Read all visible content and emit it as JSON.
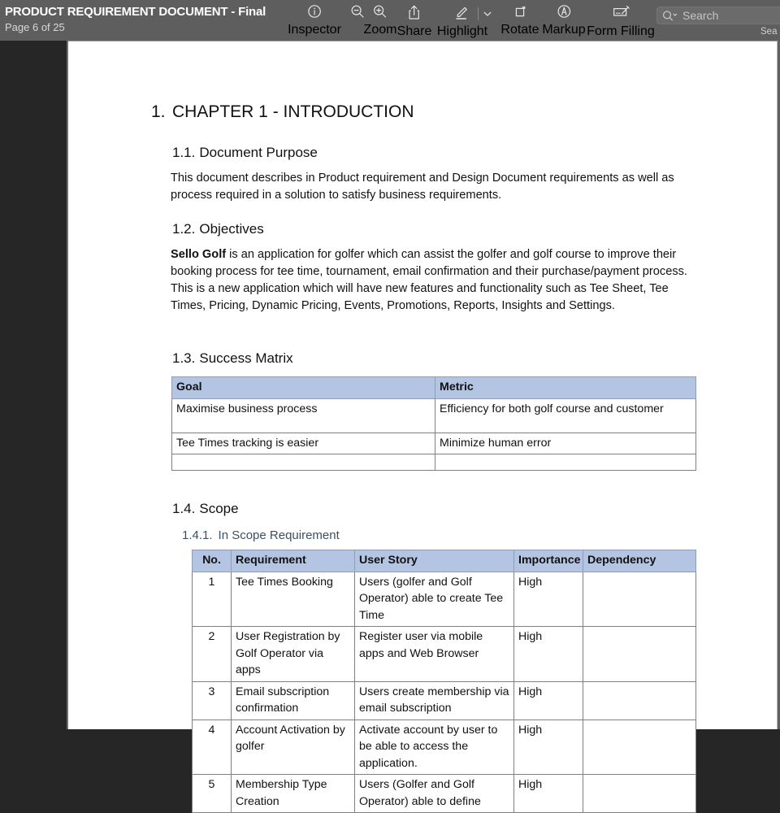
{
  "toolbar": {
    "document_title": "PRODUCT REQUIREMENT DOCUMENT - Final",
    "page_count": "Page 6 of 25",
    "tools": [
      {
        "name": "inspector",
        "icon": "info-circle-icon",
        "label": "Inspector"
      },
      {
        "name": "zoom-out",
        "icon": "zoom-out-icon",
        "label": ""
      },
      {
        "name": "zoom-in",
        "icon": "zoom-in-icon",
        "label": "Zoom"
      },
      {
        "name": "share",
        "icon": "share-icon",
        "label": "Share"
      },
      {
        "name": "highlight",
        "icon": "highlight-pen-icon",
        "label": "Highlight"
      },
      {
        "name": "rotate",
        "icon": "rotate-icon",
        "label": "Rotate"
      },
      {
        "name": "markup",
        "icon": "markup-icon",
        "label": "Markup"
      },
      {
        "name": "form-filling",
        "icon": "form-filling-icon",
        "label": "Form Filling"
      }
    ],
    "search": {
      "placeholder": "Search",
      "label": "Sea"
    }
  },
  "document": {
    "chapter": {
      "number": "1.",
      "title": "CHAPTER 1 - INTRODUCTION"
    },
    "sections": {
      "document_purpose": {
        "number": "1.1.",
        "title": "Document Purpose",
        "body": "This document describes in Product requirement and Design Document requirements as well as process required in a solution to satisfy business requirements."
      },
      "objectives": {
        "number": "1.2.",
        "title": "Objectives",
        "body_bold": "Sello Golf",
        "body": " is an application for golfer which can assist the golfer and golf course to improve their booking process for tee time, tournament, email confirmation and their purchase/payment process.  This is a new application which will have new features and functionality such as Tee Sheet, Tee Times, Pricing, Dynamic Pricing, Events, Promotions, Reports, Insights and Settings."
      },
      "success_matrix": {
        "number": "1.3.",
        "title": "Success Matrix",
        "table": {
          "headers": [
            "Goal",
            "Metric"
          ],
          "rows": [
            [
              "Maximise business process",
              "Efficiency for both golf course and customer"
            ],
            [
              "Tee Times tracking is easier",
              "Minimize human error"
            ],
            [
              "",
              ""
            ]
          ]
        }
      },
      "scope": {
        "number": "1.4.",
        "title": "Scope",
        "subsection": {
          "number": "1.4.1.",
          "title": "In Scope Requirement",
          "table": {
            "headers": [
              "No.",
              "Requirement",
              "User Story",
              "Importance",
              "Dependency"
            ],
            "rows": [
              [
                "1",
                "Tee Times Booking",
                "Users (golfer and Golf Operator) able to create Tee Time",
                "High",
                ""
              ],
              [
                "2",
                "User Registration by Golf Operator via apps",
                "Register user via mobile apps and Web Browser",
                "High",
                ""
              ],
              [
                "3",
                "Email subscription confirmation",
                "Users create membership via email subscription",
                "High",
                ""
              ],
              [
                "4",
                "Account Activation by golfer",
                "Activate account by user to be able to access the application.",
                "High",
                ""
              ],
              [
                "5",
                "Membership Type Creation",
                "Users (Golfer and Golf Operator) able to define",
                "High",
                ""
              ]
            ]
          }
        }
      }
    }
  },
  "colors": {
    "toolbar_bg": "#5e5e5e",
    "sidebar_bg": "#262626",
    "table_header_blue": "#b4c5e4",
    "heading_blue": "#3a5068"
  }
}
